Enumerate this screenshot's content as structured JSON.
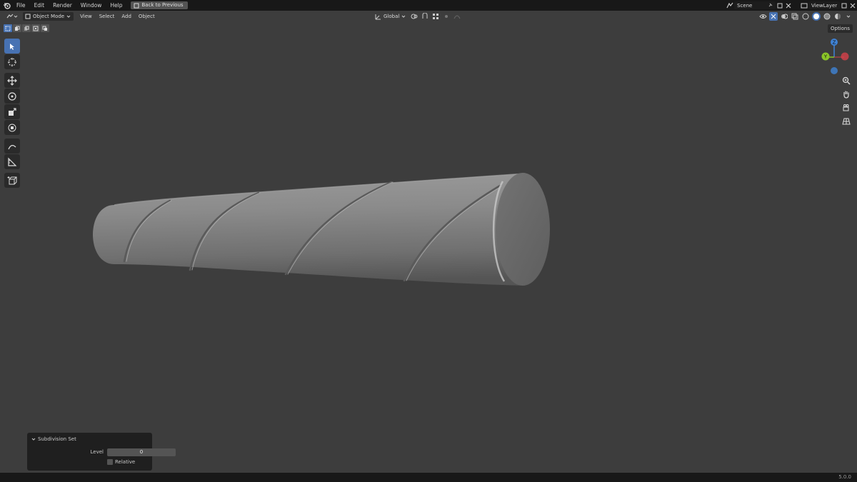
{
  "topbar": {
    "menus": [
      "File",
      "Edit",
      "Render",
      "Window",
      "Help"
    ],
    "back_button": "Back to Previous",
    "scene": "Scene",
    "view_layer": "ViewLayer"
  },
  "header": {
    "mode": "Object Mode",
    "menus": [
      "View",
      "Select",
      "Add",
      "Object"
    ],
    "transform_orientation": "Global"
  },
  "options_label": "Options",
  "gizmo": {
    "z": "Z",
    "y": "Y"
  },
  "operator_panel": {
    "title": "Subdivision Set",
    "level_label": "Level",
    "level_value": "0",
    "relative_label": "Relative"
  },
  "status": {
    "version": "5.0.0"
  },
  "colors": {
    "accent": "#4772b3",
    "axis_x": "#e0414b",
    "axis_y": "#8bc628",
    "axis_z": "#3f83d6"
  }
}
